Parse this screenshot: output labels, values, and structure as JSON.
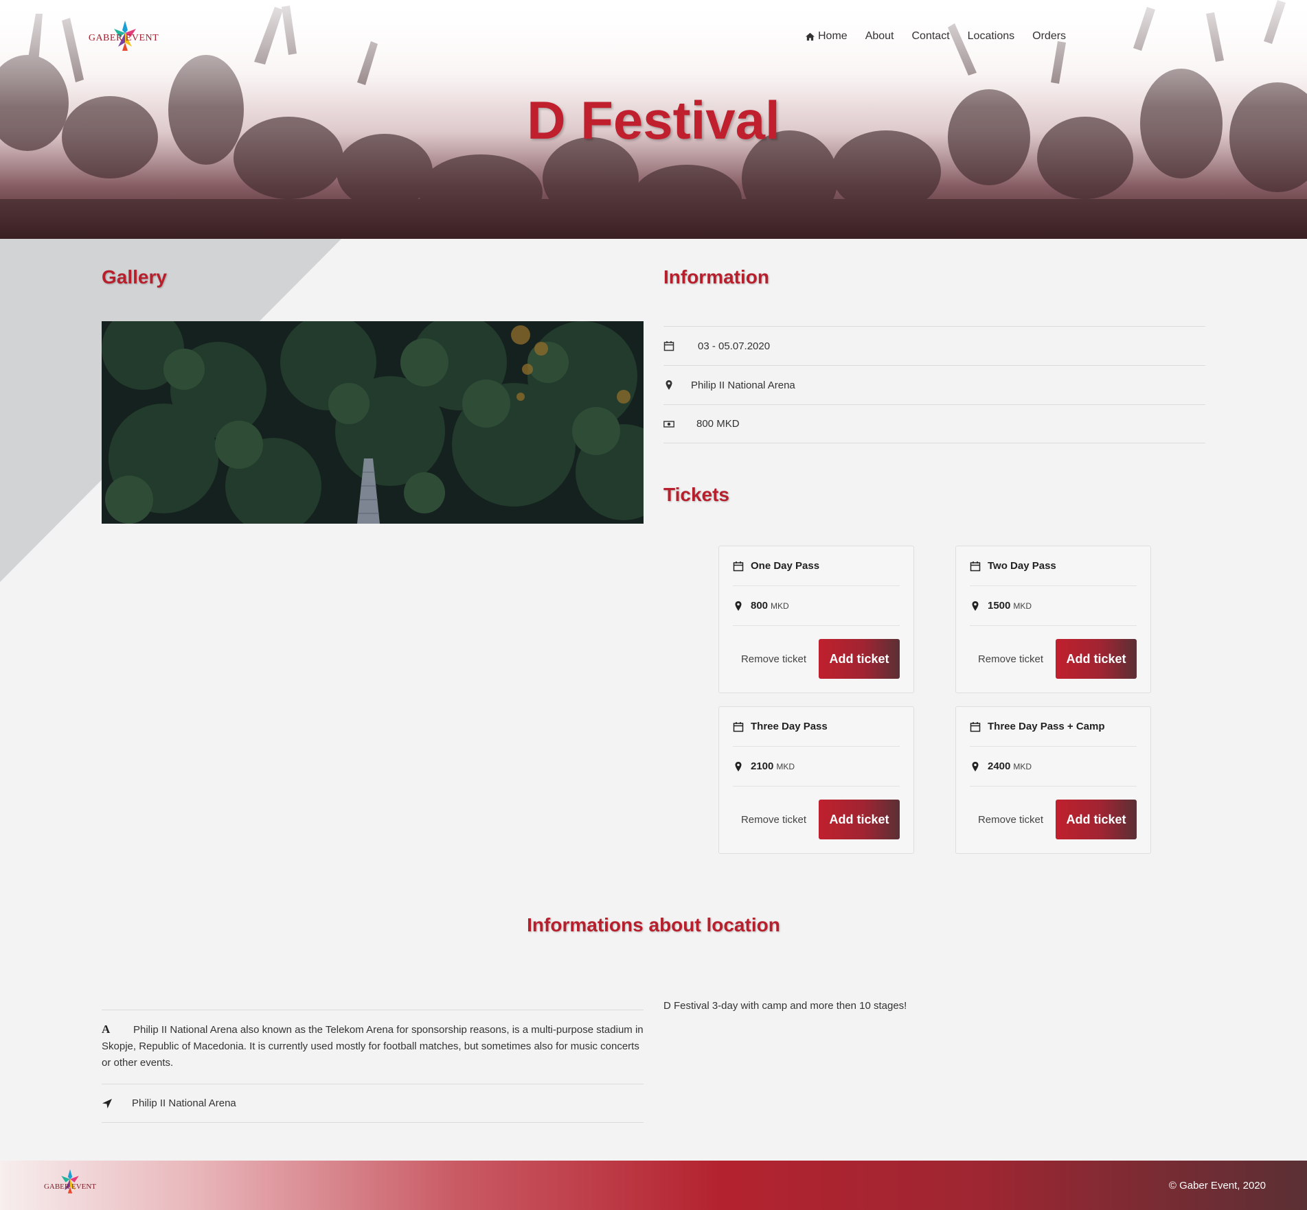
{
  "brand": {
    "logo_text": "GABER EVENT"
  },
  "nav": {
    "items": [
      {
        "label": "Home",
        "icon": "home-icon"
      },
      {
        "label": "About"
      },
      {
        "label": "Contact"
      },
      {
        "label": "Locations"
      },
      {
        "label": "Orders"
      }
    ]
  },
  "hero": {
    "title": "D Festival"
  },
  "gallery": {
    "heading": "Gallery"
  },
  "information": {
    "heading": "Information",
    "date": "03 - 05.07.2020",
    "location": "Philip II National Arena",
    "price": "800 MKD"
  },
  "tickets": {
    "heading": "Tickets",
    "remove_label": "Remove ticket",
    "add_label": "Add ticket",
    "currency": "MKD",
    "items": [
      {
        "name": "One Day Pass",
        "price": "800"
      },
      {
        "name": "Two Day Pass",
        "price": "1500"
      },
      {
        "name": "Three Day Pass",
        "price": "2100"
      },
      {
        "name": "Three Day Pass + Camp",
        "price": "2400"
      }
    ]
  },
  "location_info": {
    "heading": "Informations about location",
    "description": "Philip II National Arena also known as the Telekom Arena for sponsorship reasons, is a multi-purpose stadium in Skopje, Republic of Macedonia. It is currently used mostly for football matches, but sometimes also for music concerts or other events.",
    "address": "Philip II National Arena",
    "note": "D Festival 3-day with camp and more then 10 stages!"
  },
  "footer": {
    "logo_text": "GABER EVENT",
    "copyright": "© Gaber Event, 2020"
  },
  "colors": {
    "accent": "#c0202d",
    "text": "#333333",
    "background": "#f3f3f3"
  }
}
